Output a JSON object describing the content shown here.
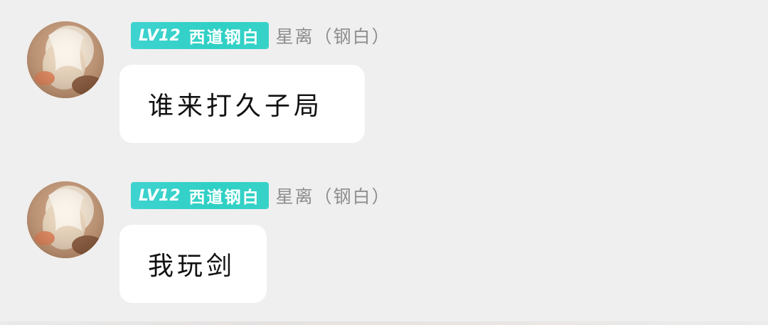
{
  "messages": [
    {
      "level": "LV12",
      "title": "西道钢白",
      "nickname": "星离（钢白）",
      "text": "谁来打久子局"
    },
    {
      "level": "LV12",
      "title": "西道钢白",
      "nickname": "星离（钢白）",
      "text": "我玩剑"
    }
  ],
  "colors": {
    "background": "#efefef",
    "badge": "#34d1c8",
    "bubble": "#ffffff",
    "nickname": "#8d8d8d"
  },
  "icons": {
    "avatar": "character-avatar"
  }
}
